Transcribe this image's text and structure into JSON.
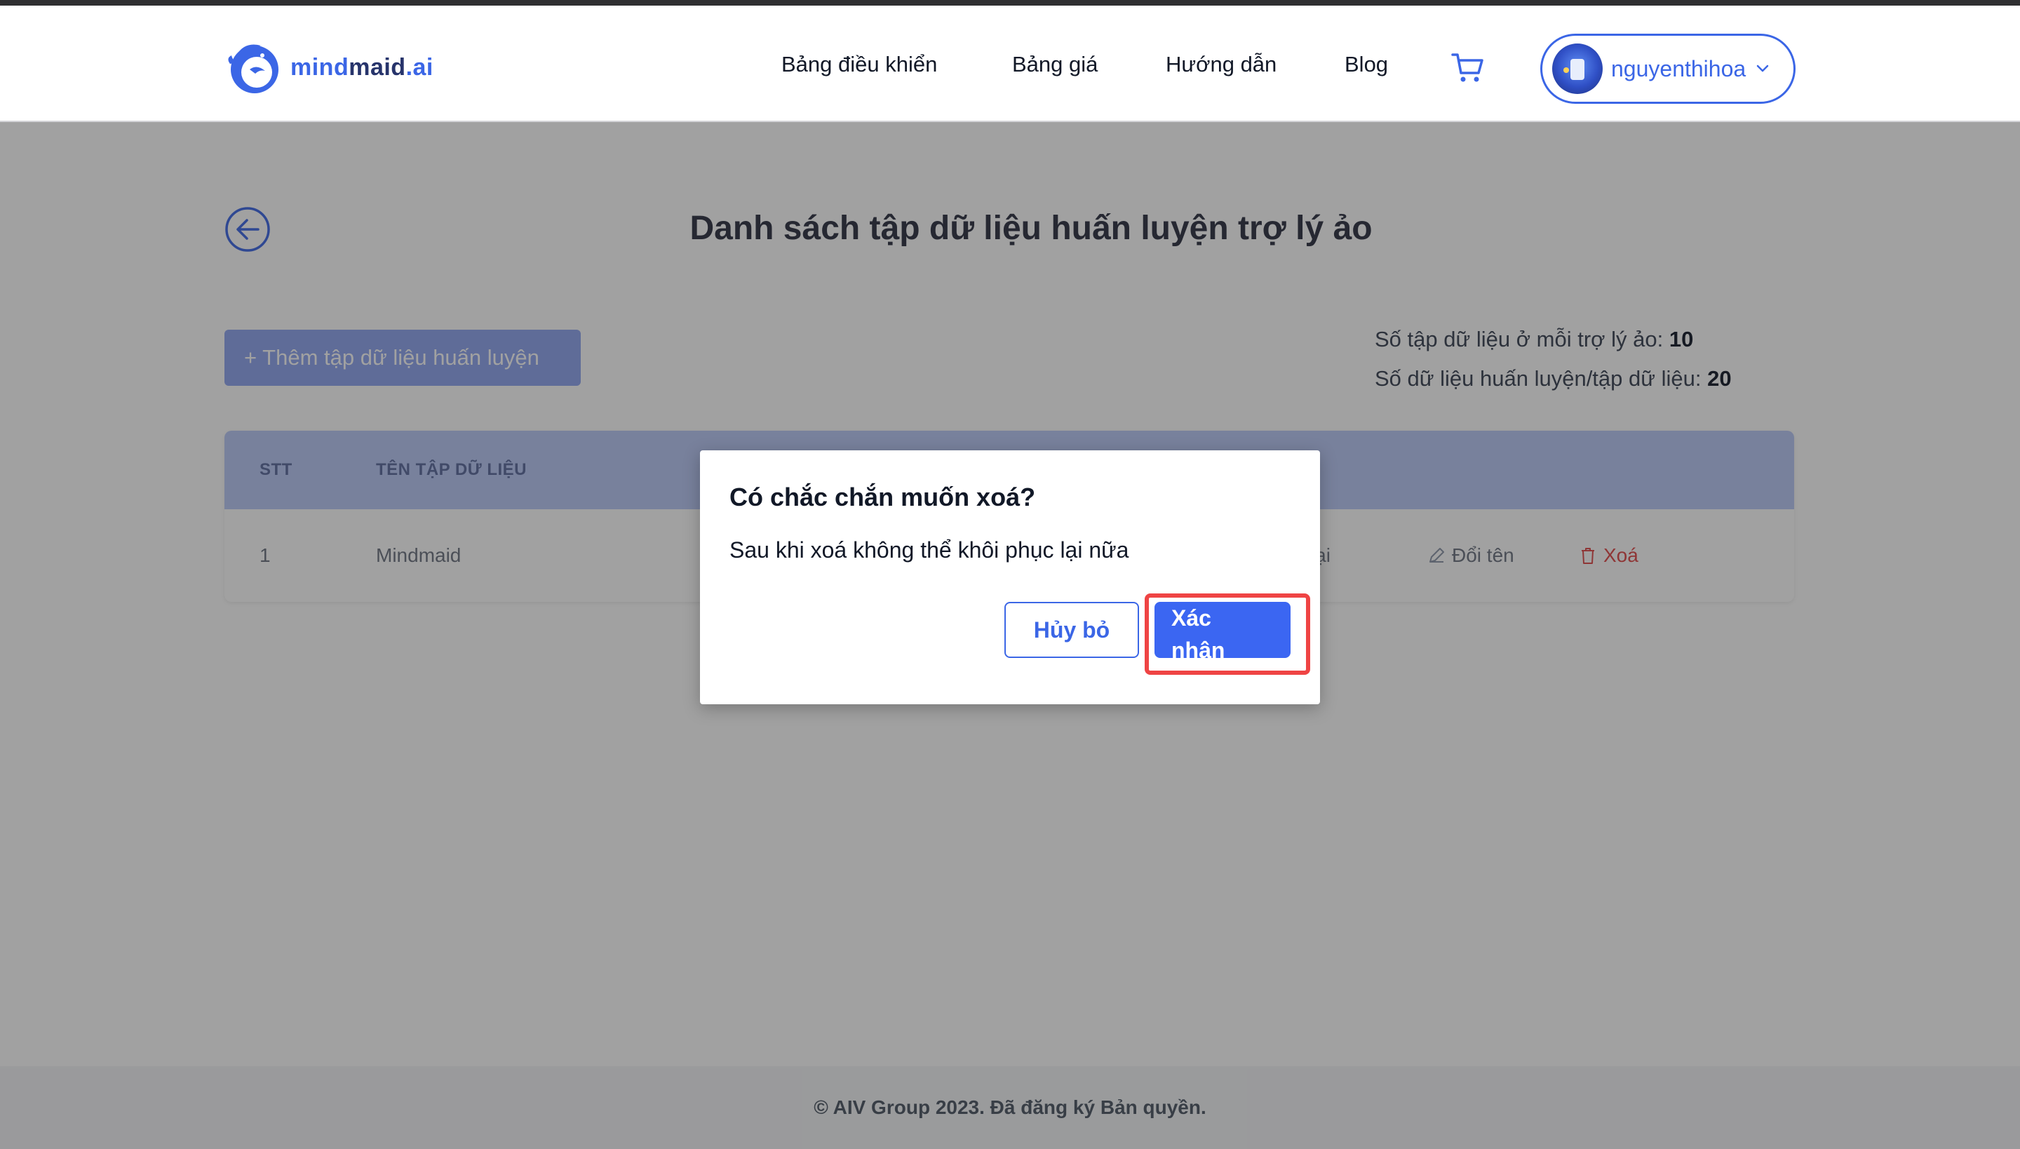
{
  "header": {
    "logo": {
      "part1": "mind",
      "part2": "maid",
      "part3": ".ai"
    },
    "nav": [
      "Bảng điều khiển",
      "Bảng giá",
      "Hướng dẫn",
      "Blog"
    ],
    "user_name": "nguyenthihoa"
  },
  "page": {
    "title": "Danh sách tập dữ liệu huấn luyện trợ lý ảo",
    "add_button": "+ Thêm tập dữ liệu huấn luyện",
    "info": {
      "datasets_label": "Số tập dữ liệu ở mỗi trợ lý ảo:",
      "datasets_value": "10",
      "items_label": "Số dữ liệu huấn luyện/tập dữ liệu:",
      "items_value": "20"
    }
  },
  "table": {
    "columns": [
      "STT",
      "TÊN TẬP DỮ LIỆU"
    ],
    "rows": [
      {
        "stt": "1",
        "name": "Mindmaid",
        "actions": [
          "ện lại",
          "Đổi tên",
          "Xoá"
        ]
      }
    ]
  },
  "modal": {
    "title": "Có chắc chắn muốn xoá?",
    "message": "Sau khi xoá không thể khôi phục lại nữa",
    "cancel_label": "Hủy bỏ",
    "confirm_label": "Xác nhận"
  },
  "footer": {
    "text": "© AIV Group 2023. Đã đăng ký Bản quyền."
  },
  "colors": {
    "primary": "#3b66e6",
    "danger": "#ef4444",
    "overlay": "rgba(30,30,32,0.42)"
  }
}
